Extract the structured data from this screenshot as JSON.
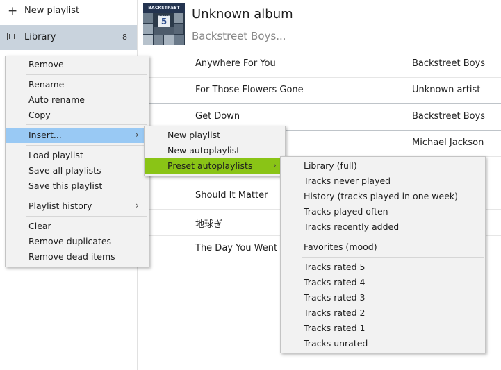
{
  "sidebar": {
    "new_playlist": "New playlist",
    "library_label": "Library",
    "library_count": "8"
  },
  "album": {
    "title": "Unknown album",
    "artist": "Backstreet Boys...",
    "art_text": "BACKSTREET BOYS",
    "art_number": "5"
  },
  "tracks": [
    {
      "title": "Anywhere For You",
      "artist": "Backstreet Boys"
    },
    {
      "title": "For Those Flowers Gone",
      "artist": "Unknown artist"
    },
    {
      "title": "Get Down",
      "artist": "Backstreet Boys"
    },
    {
      "title": "",
      "artist": "Michael Jackson"
    },
    {
      "title": "",
      "artist": ""
    },
    {
      "title": "Should It Matter",
      "artist": ""
    },
    {
      "title": "地球ぎ",
      "artist": ""
    },
    {
      "title": "The Day You Went A",
      "artist": ""
    }
  ],
  "context_menu": {
    "items": [
      "Remove",
      "Rename",
      "Auto rename",
      "Copy",
      "Insert...",
      "Load playlist",
      "Save all playlists",
      "Save this playlist",
      "Playlist history",
      "Clear",
      "Remove duplicates",
      "Remove dead items"
    ]
  },
  "insert_menu": {
    "items": [
      "New playlist",
      "New autoplaylist",
      "Preset autoplaylists"
    ]
  },
  "preset_menu": {
    "items": [
      "Library (full)",
      "Tracks never played",
      "History (tracks played in one week)",
      "Tracks played often",
      "Tracks recently added",
      "Favorites (mood)",
      "Tracks rated 5",
      "Tracks rated 4",
      "Tracks rated 3",
      "Tracks rated 2",
      "Tracks rated 1",
      "Tracks unrated"
    ]
  },
  "colors": {
    "library_selected": "#c9d3dd",
    "menu_highlight_blue": "#99c9f4",
    "menu_highlight_green": "#8ac416"
  },
  "icons": {
    "new_playlist": "plus-icon",
    "library": "library-icon",
    "submenu": "chevron-right-icon"
  }
}
